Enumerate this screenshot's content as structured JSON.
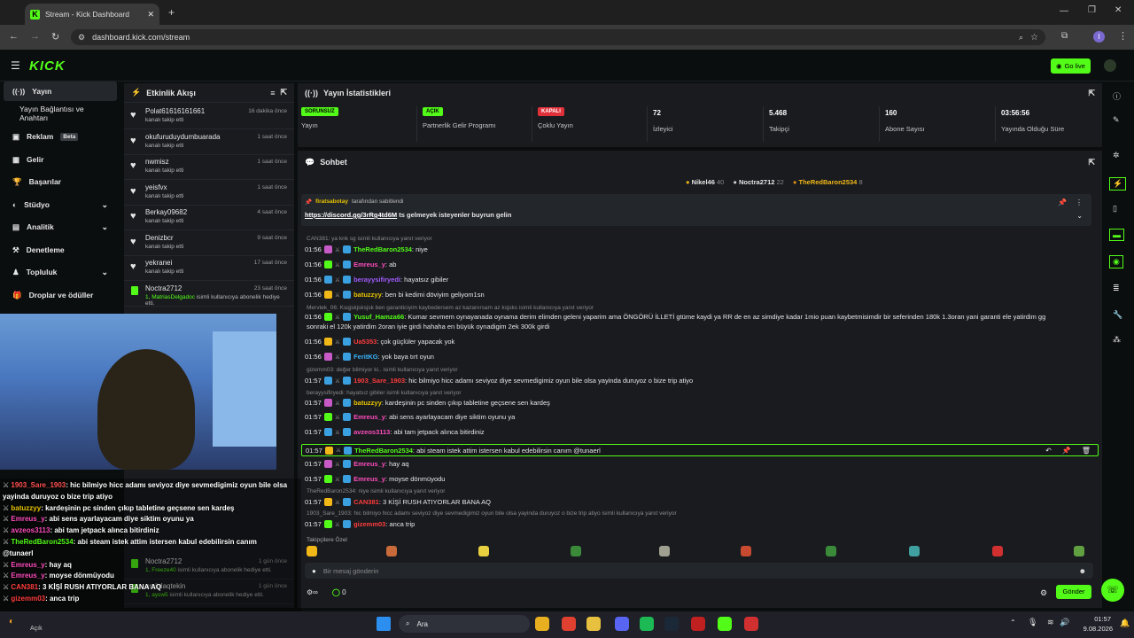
{
  "browser": {
    "tab_title": "Stream - Kick Dashboard",
    "url": "dashboard.kick.com/stream"
  },
  "app": {
    "logo": "KICK",
    "go_live": "Go live"
  },
  "nav": [
    {
      "label": "Yayın",
      "icon": "stream-icon"
    },
    {
      "label": "Yayın Bağlantısı ve Anahtarı",
      "icon": ""
    },
    {
      "label": "Reklam",
      "badge": "Beta",
      "icon": "ad-icon"
    },
    {
      "label": "Gelir",
      "icon": "money-icon"
    },
    {
      "label": "Başarılar",
      "icon": "trophy-icon"
    },
    {
      "label": "Stüdyo",
      "icon": "studio-icon"
    },
    {
      "label": "Analitik",
      "icon": "analytics-icon"
    },
    {
      "label": "Denetleme",
      "icon": "moderation-icon"
    },
    {
      "label": "Topluluk",
      "icon": "community-icon"
    },
    {
      "label": "Droplar ve ödüller",
      "icon": "gift-icon"
    }
  ],
  "activity": {
    "title": "Etkinlik Akışı",
    "items": [
      {
        "name": "Polat61616161661",
        "sub": "kanalı takip etti",
        "time": "16 dakika önce",
        "type": "follow"
      },
      {
        "name": "okufuruduydumbuarada",
        "sub": "kanalı takip etti",
        "time": "1 saat önce",
        "type": "follow"
      },
      {
        "name": "nwmisz",
        "sub": "kanalı takip etti",
        "time": "1 saat önce",
        "type": "follow"
      },
      {
        "name": "yeisfvx",
        "sub": "kanalı takip etti",
        "time": "1 saat önce",
        "type": "follow"
      },
      {
        "name": "Berkay09682",
        "sub": "kanalı takip etti",
        "time": "4 saat önce",
        "type": "follow"
      },
      {
        "name": "Denizbcr",
        "sub": "kanalı takip etti",
        "time": "9 saat önce",
        "type": "follow"
      },
      {
        "name": "yekranei",
        "sub": "kanalı takip etti",
        "time": "17 saat önce",
        "type": "follow"
      },
      {
        "name": "Noctra2712",
        "sub_prefix": "1, ",
        "sub_user": "MatriasDelgadoc",
        "sub": " isimli kullanıcıya abonelik hediye etti.",
        "time": "23 saat önce",
        "type": "gift"
      }
    ],
    "bottom": [
      {
        "name": "Noctra2712",
        "sub_prefix": "1, ",
        "sub_user": "Freeze40",
        "sub": " isimli kullanıcıya abonelik hediye etti.",
        "time": "1 gün önce"
      },
      {
        "name": "umitdaqtekin",
        "sub_prefix": "1, ",
        "sub_user": "aysw5",
        "sub": " isimli kullanıcıya abonelik hediye etti.",
        "time": "1 gün önce"
      }
    ]
  },
  "stats": {
    "title": "Yayın İstatistikleri",
    "items": [
      {
        "badge": "SORUNSUZ",
        "color": "#53fc18",
        "label": "Yayın"
      },
      {
        "badge": "AÇIK",
        "color": "#53fc18",
        "label": "Partnerlik Gelir Programı"
      },
      {
        "badge": "KAPALI",
        "color": "#e0313a",
        "label": "Çoklu Yayın"
      },
      {
        "value": "72",
        "label": "İzleyici"
      },
      {
        "value": "5.468",
        "label": "Takipçi"
      },
      {
        "value": "160",
        "label": "Abone Sayısı"
      },
      {
        "value": "03:56:56",
        "label": "Yayında Olduğu Süre"
      }
    ]
  },
  "chat": {
    "title": "Sohbet",
    "top_gifters": [
      {
        "name": "Nikel46",
        "n": "40"
      },
      {
        "name": "Noctra2712",
        "n": "22"
      },
      {
        "name": "TheRedBaron2534",
        "n": "8"
      }
    ],
    "pinned": {
      "by": "firatsabotay",
      "by_suffix": "tarafından sabitlendi",
      "link": "https://discord.gg/3rRg4td6M",
      "text": "ts gelmeyek isteyenler buyrun gelin"
    },
    "messages": [
      {
        "reply": "CAN381: ya knk sg isimli kullanıcıya yanıt veriyor"
      },
      {
        "t": "01:56",
        "u": "TheRedBaron2534",
        "c": "u1",
        "m": ": niye"
      },
      {
        "t": "01:56",
        "u": "Emreus_y",
        "c": "u2",
        "m": ": ab"
      },
      {
        "t": "01:56",
        "u": "berayysifiryedi",
        "c": "u3",
        "m": ": hayatsız gibiler"
      },
      {
        "t": "01:56",
        "u": "batuzzyy",
        "c": "u5",
        "m": ": ben bi kedimi döviyim geliyom1sn"
      },
      {
        "reply": "Mervtek_06: Ksqjskjsksjsk ben garanticiyim kaybedersem az kazanırsam az ksjsks isimli kullanıcıya yanıt veriyor"
      },
      {
        "t": "01:56",
        "u": "Yusuf_Hamza66",
        "c": "u1",
        "m": ": Kumar sevmem oynayanada oynama derim elimden geleni yaparim ama ÖNGÖRÜ İLLETİ gtüme kaydi ya RR de en az simdiye kadar 1mio puan kaybetmisimdir bir seferinden 180k 1.3oran yani garanti ele yatirdim gg"
      },
      {
        "cont": "sonraki el 120k yatirdim 2oran iyie girdi hahaha en büyük oynadigim 2ek 300k girdi"
      },
      {
        "t": "01:56",
        "u": "Ua5353",
        "c": "u4",
        "m": ": çok güçlüler yapacak yok"
      },
      {
        "t": "01:56",
        "u": "FeritKG",
        "c": "u6",
        "m": ": yok baya tırt oyun"
      },
      {
        "reply": "gizemm03: değer bilmiyor ki.. isimli kullanıcıya yanıt veriyor"
      },
      {
        "t": "01:57",
        "u": "1903_Sare_1903",
        "c": "u4",
        "m": ": hic bilmiyo hicc adamı seviyoz diye sevmedigimiz oyun bile olsa yayinda duruyoz o bize trip atiyo"
      },
      {
        "reply": "berayysifiryedi: hayatsız gibiler isimli kullanıcıya yanıt veriyor"
      },
      {
        "t": "01:57",
        "u": "batuzzyy",
        "c": "u5",
        "m": ": kardeşinin pc sinden çıkıp tabletine geçsene sen kardeş"
      },
      {
        "t": "01:57",
        "u": "Emreus_y",
        "c": "u2",
        "m": ": abi sens ayarlayacam diye siktim oyunu ya"
      },
      {
        "t": "01:57",
        "u": "avzeos3113",
        "c": "u2",
        "m": ": abi tam jetpack alınca bitirdiniz"
      },
      {
        "t": "01:57",
        "u": "TheRedBaron2534",
        "c": "u1",
        "m": ": abi steam istek attim istersen kabul edebilirsin canım @tunaerl",
        "hl": true
      },
      {
        "t": "01:57",
        "u": "Emreus_y",
        "c": "u2",
        "m": ": hay aq"
      },
      {
        "t": "01:57",
        "u": "Emreus_y",
        "c": "u2",
        "m": ": moyse dönmüyodu"
      },
      {
        "reply": "TheRedBaron2534: niye isimli kullanıcıya yanıt veriyor"
      },
      {
        "t": "01:57",
        "u": "CAN381",
        "c": "u4",
        "m": ": 3 KİŞİ RUSH ATIYORLAR BANA AQ"
      },
      {
        "reply": "1903_Sare_1903: hic bilmiyo hicc adamı seviyoz diye sevmedigimiz oyun bile olsa yayinda duruyoz o bize trip atiyo isimli kullanıcıya yanıt veriyor"
      },
      {
        "t": "01:57",
        "u": "gizemm03",
        "c": "u4",
        "m": ": anca trip"
      }
    ],
    "emote_label": "Takipçilere Özel",
    "input_placeholder": "Bir mesaj gönderin",
    "points": "0",
    "send": "Gönder"
  },
  "overlay": [
    {
      "u": "1903_Sare_1903",
      "c": "#ff5050",
      "m": ": hic bilmiyo hicc adamı seviyoz diye sevmedigimiz oyun bile olsa"
    },
    {
      "cont": "yayinda duruyoz o bize trip atiyo"
    },
    {
      "u": "batuzzyy",
      "c": "#e8c400",
      "m": ": kardeşinin pc sinden çıkıp tabletine geçsene sen kardeş"
    },
    {
      "u": "Emreus_y",
      "c": "#ff4cbd",
      "m": ": abi sens ayarlayacam diye siktim oyunu ya"
    },
    {
      "u": "avzeos3113",
      "c": "#ff4cbd",
      "m": ": abi tam jetpack alınca bitirdiniz"
    },
    {
      "u": "TheRedBaron2534",
      "c": "#53fc18",
      "m": ": abi steam istek attim istersen kabul edebilirsin canım"
    },
    {
      "cont": "@tunaerl"
    },
    {
      "u": "Emreus_y",
      "c": "#ff4cbd",
      "m": ": hay aq"
    },
    {
      "u": "Emreus_y",
      "c": "#ff4cbd",
      "m": ": moyse dönmüyodu"
    },
    {
      "u": "CAN381",
      "c": "#ff3c3c",
      "m": ": 3 KİŞİ RUSH ATIYORLAR BANA AQ"
    },
    {
      "u": "gizemm03",
      "c": "#ff3c3c",
      "m": ": anca trip"
    }
  ],
  "taskbar": {
    "weather": "Açık",
    "search": "Ara",
    "time": "01:57",
    "date": "9.08.2026"
  }
}
